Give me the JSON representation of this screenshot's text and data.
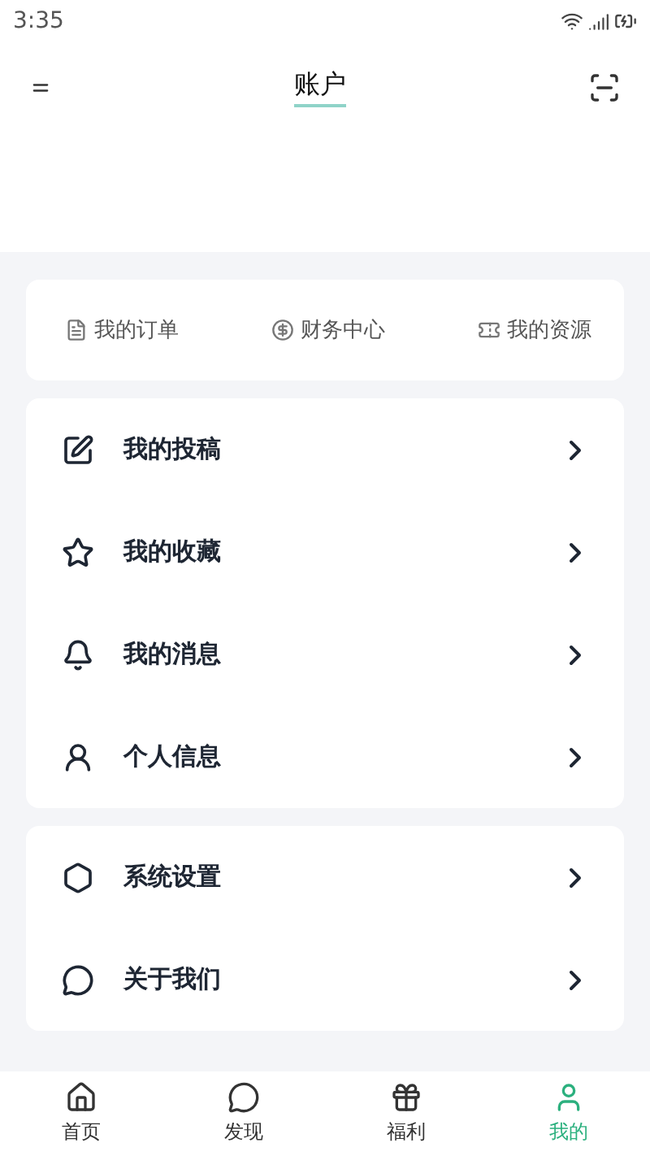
{
  "status_bar": {
    "time": "3:35"
  },
  "header": {
    "title": "账户"
  },
  "quick_links": [
    "我的订单",
    "财务中心",
    "我的资源"
  ],
  "menu_groups": [
    [
      "我的投稿",
      "我的收藏",
      "我的消息",
      "个人信息"
    ],
    [
      "系统设置",
      "关于我们"
    ]
  ],
  "bottom_nav": [
    {
      "label": "首页",
      "selected": false
    },
    {
      "label": "发现",
      "selected": false
    },
    {
      "label": "福利",
      "selected": false
    },
    {
      "label": "我的",
      "selected": true
    }
  ]
}
